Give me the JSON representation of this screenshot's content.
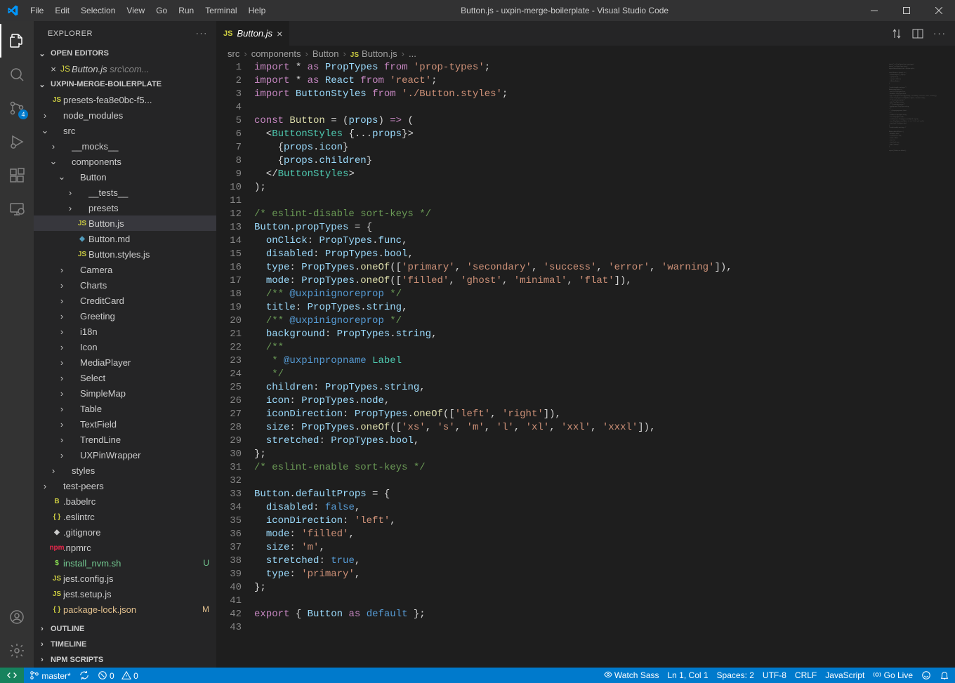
{
  "menubar": [
    "File",
    "Edit",
    "Selection",
    "View",
    "Go",
    "Run",
    "Terminal",
    "Help"
  ],
  "windowTitle": "Button.js - uxpin-merge-boilerplate - Visual Studio Code",
  "sidebar": {
    "title": "EXPLORER",
    "sections": {
      "openEditors": {
        "label": "OPEN EDITORS"
      },
      "project": {
        "label": "UXPIN-MERGE-BOILERPLATE"
      },
      "outline": {
        "label": "OUTLINE"
      },
      "timeline": {
        "label": "TIMELINE"
      },
      "npmScripts": {
        "label": "NPM SCRIPTS"
      }
    },
    "openEditor": {
      "name": "Button.js",
      "path": "src\\com..."
    },
    "tree": [
      {
        "d": 0,
        "t": "file",
        "icon": "js",
        "name": "presets-fea8e0bc-f5..."
      },
      {
        "d": 0,
        "t": "folder",
        "open": false,
        "name": "node_modules"
      },
      {
        "d": 0,
        "t": "folder",
        "open": true,
        "name": "src"
      },
      {
        "d": 1,
        "t": "folder",
        "open": false,
        "name": "__mocks__"
      },
      {
        "d": 1,
        "t": "folder",
        "open": true,
        "name": "components"
      },
      {
        "d": 2,
        "t": "folder",
        "open": true,
        "name": "Button"
      },
      {
        "d": 3,
        "t": "folder",
        "open": false,
        "name": "__tests__"
      },
      {
        "d": 3,
        "t": "folder",
        "open": false,
        "name": "presets"
      },
      {
        "d": 3,
        "t": "file",
        "icon": "js",
        "name": "Button.js",
        "active": true
      },
      {
        "d": 3,
        "t": "file",
        "icon": "md",
        "name": "Button.md"
      },
      {
        "d": 3,
        "t": "file",
        "icon": "js",
        "name": "Button.styles.js"
      },
      {
        "d": 2,
        "t": "folder",
        "open": false,
        "name": "Camera"
      },
      {
        "d": 2,
        "t": "folder",
        "open": false,
        "name": "Charts"
      },
      {
        "d": 2,
        "t": "folder",
        "open": false,
        "name": "CreditCard"
      },
      {
        "d": 2,
        "t": "folder",
        "open": false,
        "name": "Greeting"
      },
      {
        "d": 2,
        "t": "folder",
        "open": false,
        "name": "i18n"
      },
      {
        "d": 2,
        "t": "folder",
        "open": false,
        "name": "Icon"
      },
      {
        "d": 2,
        "t": "folder",
        "open": false,
        "name": "MediaPlayer"
      },
      {
        "d": 2,
        "t": "folder",
        "open": false,
        "name": "Select"
      },
      {
        "d": 2,
        "t": "folder",
        "open": false,
        "name": "SimpleMap"
      },
      {
        "d": 2,
        "t": "folder",
        "open": false,
        "name": "Table"
      },
      {
        "d": 2,
        "t": "folder",
        "open": false,
        "name": "TextField"
      },
      {
        "d": 2,
        "t": "folder",
        "open": false,
        "name": "TrendLine"
      },
      {
        "d": 2,
        "t": "folder",
        "open": false,
        "name": "UXPinWrapper"
      },
      {
        "d": 1,
        "t": "folder",
        "open": false,
        "name": "styles"
      },
      {
        "d": 0,
        "t": "folder",
        "open": false,
        "name": "test-peers"
      },
      {
        "d": 0,
        "t": "file",
        "icon": "babel",
        "name": ".babelrc"
      },
      {
        "d": 0,
        "t": "file",
        "icon": "json",
        "name": ".eslintrc"
      },
      {
        "d": 0,
        "t": "file",
        "icon": "git",
        "name": ".gitignore"
      },
      {
        "d": 0,
        "t": "file",
        "icon": "npm",
        "name": ".npmrc"
      },
      {
        "d": 0,
        "t": "file",
        "icon": "sh",
        "name": "install_nvm.sh",
        "status": "U"
      },
      {
        "d": 0,
        "t": "file",
        "icon": "js",
        "name": "jest.config.js"
      },
      {
        "d": 0,
        "t": "file",
        "icon": "js",
        "name": "jest.setup.js"
      },
      {
        "d": 0,
        "t": "file",
        "icon": "json",
        "name": "package-lock.json",
        "status": "M"
      }
    ]
  },
  "activitybar": {
    "scmBadge": "4"
  },
  "tab": {
    "name": "Button.js"
  },
  "breadcrumbs": [
    "src",
    "components",
    "Button",
    "Button.js",
    "..."
  ],
  "code": {
    "lines": [
      [
        [
          "kw",
          "import"
        ],
        [
          "punc",
          " * "
        ],
        [
          "kw",
          "as"
        ],
        [
          "punc",
          " "
        ],
        [
          "var",
          "PropTypes"
        ],
        [
          "punc",
          " "
        ],
        [
          "kw",
          "from"
        ],
        [
          "punc",
          " "
        ],
        [
          "str",
          "'prop-types'"
        ],
        [
          "punc",
          ";"
        ]
      ],
      [
        [
          "kw",
          "import"
        ],
        [
          "punc",
          " * "
        ],
        [
          "kw",
          "as"
        ],
        [
          "punc",
          " "
        ],
        [
          "var",
          "React"
        ],
        [
          "punc",
          " "
        ],
        [
          "kw",
          "from"
        ],
        [
          "punc",
          " "
        ],
        [
          "str",
          "'react'"
        ],
        [
          "punc",
          ";"
        ]
      ],
      [
        [
          "kw",
          "import"
        ],
        [
          "punc",
          " "
        ],
        [
          "var",
          "ButtonStyles"
        ],
        [
          "punc",
          " "
        ],
        [
          "kw",
          "from"
        ],
        [
          "punc",
          " "
        ],
        [
          "str",
          "'./Button.styles'"
        ],
        [
          "punc",
          ";"
        ]
      ],
      [],
      [
        [
          "kw",
          "const"
        ],
        [
          "punc",
          " "
        ],
        [
          "fn",
          "Button"
        ],
        [
          "punc",
          " = ("
        ],
        [
          "var",
          "props"
        ],
        [
          "punc",
          ") "
        ],
        [
          "kw",
          "=>"
        ],
        [
          "punc",
          " ("
        ]
      ],
      [
        [
          "punc",
          "  <"
        ],
        [
          "tag",
          "ButtonStyles"
        ],
        [
          "punc",
          " {..."
        ],
        [
          "var",
          "props"
        ],
        [
          "punc",
          "}>"
        ]
      ],
      [
        [
          "punc",
          "    {"
        ],
        [
          "var",
          "props"
        ],
        [
          "punc",
          "."
        ],
        [
          "var",
          "icon"
        ],
        [
          "punc",
          "}"
        ]
      ],
      [
        [
          "punc",
          "    {"
        ],
        [
          "var",
          "props"
        ],
        [
          "punc",
          "."
        ],
        [
          "var",
          "children"
        ],
        [
          "punc",
          "}"
        ]
      ],
      [
        [
          "punc",
          "  </"
        ],
        [
          "tag",
          "ButtonStyles"
        ],
        [
          "punc",
          ">"
        ]
      ],
      [
        [
          "punc",
          ");"
        ]
      ],
      [],
      [
        [
          "comment",
          "/* eslint-disable sort-keys */"
        ]
      ],
      [
        [
          "var",
          "Button"
        ],
        [
          "punc",
          "."
        ],
        [
          "var",
          "propTypes"
        ],
        [
          "punc",
          " = {"
        ]
      ],
      [
        [
          "punc",
          "  "
        ],
        [
          "attr",
          "onClick"
        ],
        [
          "punc",
          ": "
        ],
        [
          "var",
          "PropTypes"
        ],
        [
          "punc",
          "."
        ],
        [
          "var",
          "func"
        ],
        [
          "punc",
          ","
        ]
      ],
      [
        [
          "punc",
          "  "
        ],
        [
          "attr",
          "disabled"
        ],
        [
          "punc",
          ": "
        ],
        [
          "var",
          "PropTypes"
        ],
        [
          "punc",
          "."
        ],
        [
          "var",
          "bool"
        ],
        [
          "punc",
          ","
        ]
      ],
      [
        [
          "punc",
          "  "
        ],
        [
          "attr",
          "type"
        ],
        [
          "punc",
          ": "
        ],
        [
          "var",
          "PropTypes"
        ],
        [
          "punc",
          "."
        ],
        [
          "fn",
          "oneOf"
        ],
        [
          "punc",
          "(["
        ],
        [
          "str",
          "'primary'"
        ],
        [
          "punc",
          ", "
        ],
        [
          "str",
          "'secondary'"
        ],
        [
          "punc",
          ", "
        ],
        [
          "str",
          "'success'"
        ],
        [
          "punc",
          ", "
        ],
        [
          "str",
          "'error'"
        ],
        [
          "punc",
          ", "
        ],
        [
          "str",
          "'warning'"
        ],
        [
          "punc",
          "]),"
        ]
      ],
      [
        [
          "punc",
          "  "
        ],
        [
          "attr",
          "mode"
        ],
        [
          "punc",
          ": "
        ],
        [
          "var",
          "PropTypes"
        ],
        [
          "punc",
          "."
        ],
        [
          "fn",
          "oneOf"
        ],
        [
          "punc",
          "(["
        ],
        [
          "str",
          "'filled'"
        ],
        [
          "punc",
          ", "
        ],
        [
          "str",
          "'ghost'"
        ],
        [
          "punc",
          ", "
        ],
        [
          "str",
          "'minimal'"
        ],
        [
          "punc",
          ", "
        ],
        [
          "str",
          "'flat'"
        ],
        [
          "punc",
          "]),"
        ]
      ],
      [
        [
          "punc",
          "  "
        ],
        [
          "comment",
          "/** "
        ],
        [
          "doctag",
          "@uxpinignoreprop"
        ],
        [
          "comment",
          " */"
        ]
      ],
      [
        [
          "punc",
          "  "
        ],
        [
          "attr",
          "title"
        ],
        [
          "punc",
          ": "
        ],
        [
          "var",
          "PropTypes"
        ],
        [
          "punc",
          "."
        ],
        [
          "var",
          "string"
        ],
        [
          "punc",
          ","
        ]
      ],
      [
        [
          "punc",
          "  "
        ],
        [
          "comment",
          "/** "
        ],
        [
          "doctag",
          "@uxpinignoreprop"
        ],
        [
          "comment",
          " */"
        ]
      ],
      [
        [
          "punc",
          "  "
        ],
        [
          "attr",
          "background"
        ],
        [
          "punc",
          ": "
        ],
        [
          "var",
          "PropTypes"
        ],
        [
          "punc",
          "."
        ],
        [
          "var",
          "string"
        ],
        [
          "punc",
          ","
        ]
      ],
      [
        [
          "punc",
          "  "
        ],
        [
          "comment",
          "/**"
        ]
      ],
      [
        [
          "punc",
          "  "
        ],
        [
          "comment",
          " * "
        ],
        [
          "doctag",
          "@uxpinpropname"
        ],
        [
          "comment",
          " "
        ],
        [
          "type",
          "Label"
        ]
      ],
      [
        [
          "punc",
          "  "
        ],
        [
          "comment",
          " */"
        ]
      ],
      [
        [
          "punc",
          "  "
        ],
        [
          "attr",
          "children"
        ],
        [
          "punc",
          ": "
        ],
        [
          "var",
          "PropTypes"
        ],
        [
          "punc",
          "."
        ],
        [
          "var",
          "string"
        ],
        [
          "punc",
          ","
        ]
      ],
      [
        [
          "punc",
          "  "
        ],
        [
          "attr",
          "icon"
        ],
        [
          "punc",
          ": "
        ],
        [
          "var",
          "PropTypes"
        ],
        [
          "punc",
          "."
        ],
        [
          "var",
          "node"
        ],
        [
          "punc",
          ","
        ]
      ],
      [
        [
          "punc",
          "  "
        ],
        [
          "attr",
          "iconDirection"
        ],
        [
          "punc",
          ": "
        ],
        [
          "var",
          "PropTypes"
        ],
        [
          "punc",
          "."
        ],
        [
          "fn",
          "oneOf"
        ],
        [
          "punc",
          "(["
        ],
        [
          "str",
          "'left'"
        ],
        [
          "punc",
          ", "
        ],
        [
          "str",
          "'right'"
        ],
        [
          "punc",
          "]),"
        ]
      ],
      [
        [
          "punc",
          "  "
        ],
        [
          "attr",
          "size"
        ],
        [
          "punc",
          ": "
        ],
        [
          "var",
          "PropTypes"
        ],
        [
          "punc",
          "."
        ],
        [
          "fn",
          "oneOf"
        ],
        [
          "punc",
          "(["
        ],
        [
          "str",
          "'xs'"
        ],
        [
          "punc",
          ", "
        ],
        [
          "str",
          "'s'"
        ],
        [
          "punc",
          ", "
        ],
        [
          "str",
          "'m'"
        ],
        [
          "punc",
          ", "
        ],
        [
          "str",
          "'l'"
        ],
        [
          "punc",
          ", "
        ],
        [
          "str",
          "'xl'"
        ],
        [
          "punc",
          ", "
        ],
        [
          "str",
          "'xxl'"
        ],
        [
          "punc",
          ", "
        ],
        [
          "str",
          "'xxxl'"
        ],
        [
          "punc",
          "]),"
        ]
      ],
      [
        [
          "punc",
          "  "
        ],
        [
          "attr",
          "stretched"
        ],
        [
          "punc",
          ": "
        ],
        [
          "var",
          "PropTypes"
        ],
        [
          "punc",
          "."
        ],
        [
          "var",
          "bool"
        ],
        [
          "punc",
          ","
        ]
      ],
      [
        [
          "punc",
          "};"
        ]
      ],
      [
        [
          "comment",
          "/* eslint-enable sort-keys */"
        ]
      ],
      [],
      [
        [
          "var",
          "Button"
        ],
        [
          "punc",
          "."
        ],
        [
          "var",
          "defaultProps"
        ],
        [
          "punc",
          " = {"
        ]
      ],
      [
        [
          "punc",
          "  "
        ],
        [
          "attr",
          "disabled"
        ],
        [
          "punc",
          ": "
        ],
        [
          "bool",
          "false"
        ],
        [
          "punc",
          ","
        ]
      ],
      [
        [
          "punc",
          "  "
        ],
        [
          "attr",
          "iconDirection"
        ],
        [
          "punc",
          ": "
        ],
        [
          "str",
          "'left'"
        ],
        [
          "punc",
          ","
        ]
      ],
      [
        [
          "punc",
          "  "
        ],
        [
          "attr",
          "mode"
        ],
        [
          "punc",
          ": "
        ],
        [
          "str",
          "'filled'"
        ],
        [
          "punc",
          ","
        ]
      ],
      [
        [
          "punc",
          "  "
        ],
        [
          "attr",
          "size"
        ],
        [
          "punc",
          ": "
        ],
        [
          "str",
          "'m'"
        ],
        [
          "punc",
          ","
        ]
      ],
      [
        [
          "punc",
          "  "
        ],
        [
          "attr",
          "stretched"
        ],
        [
          "punc",
          ": "
        ],
        [
          "bool",
          "true"
        ],
        [
          "punc",
          ","
        ]
      ],
      [
        [
          "punc",
          "  "
        ],
        [
          "attr",
          "type"
        ],
        [
          "punc",
          ": "
        ],
        [
          "str",
          "'primary'"
        ],
        [
          "punc",
          ","
        ]
      ],
      [
        [
          "punc",
          "};"
        ]
      ],
      [],
      [
        [
          "kw",
          "export"
        ],
        [
          "punc",
          " { "
        ],
        [
          "var",
          "Button"
        ],
        [
          "punc",
          " "
        ],
        [
          "kw",
          "as"
        ],
        [
          "punc",
          " "
        ],
        [
          "bool",
          "default"
        ],
        [
          "punc",
          " };"
        ]
      ],
      []
    ]
  },
  "statusbar": {
    "branch": "master*",
    "sync": "",
    "errors": "0",
    "warnings": "0",
    "watchSass": "Watch Sass",
    "cursor": "Ln 1, Col 1",
    "spaces": "Spaces: 2",
    "encoding": "UTF-8",
    "eol": "CRLF",
    "language": "JavaScript",
    "goLive": "Go Live"
  }
}
